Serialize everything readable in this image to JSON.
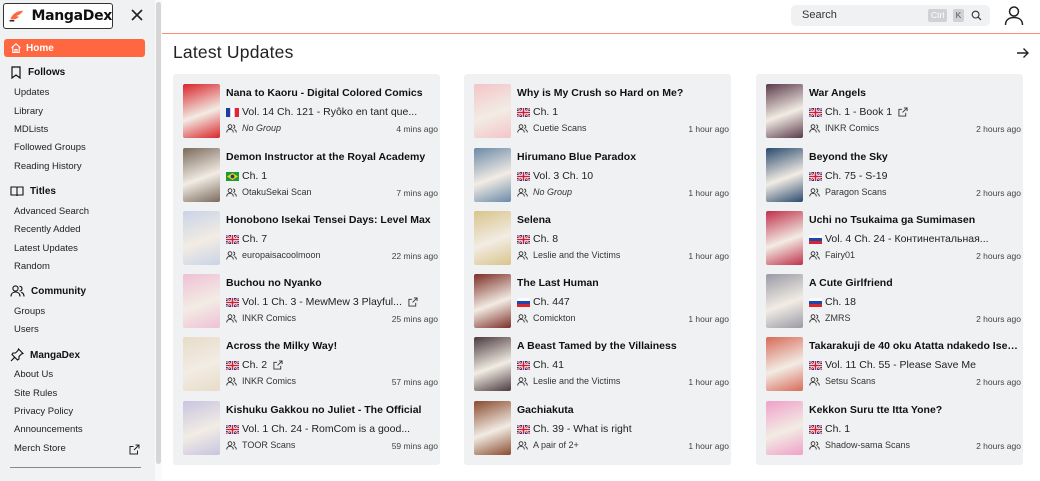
{
  "app": {
    "name": "MangaDex",
    "brand_color": "#ff6740"
  },
  "sidebar": {
    "home_label": "Home",
    "sections": [
      {
        "title": "Follows",
        "icon": "bookmark-icon",
        "items": [
          "Updates",
          "Library",
          "MDLists",
          "Followed Groups",
          "Reading History"
        ]
      },
      {
        "title": "Titles",
        "icon": "book-open-icon",
        "items": [
          "Advanced Search",
          "Recently Added",
          "Latest Updates",
          "Random"
        ]
      },
      {
        "title": "Community",
        "icon": "users-icon",
        "items": [
          "Groups",
          "Users"
        ]
      },
      {
        "title": "MangaDex",
        "icon": "pin-icon",
        "items": [
          "About Us",
          "Site Rules",
          "Privacy Policy",
          "Announcements",
          "Merch Store"
        ]
      }
    ]
  },
  "search": {
    "placeholder": "Search",
    "kbd_mod": "Ctrl",
    "kbd_key": "K"
  },
  "main": {
    "title": "Latest Updates"
  },
  "columns": [
    [
      {
        "title": "Nana to Kaoru - Digital Colored Comics",
        "flag": "fr",
        "chapter": "Vol. 14 Ch. 121 - Ryôko en tant que...",
        "group": "No Group",
        "group_italic": true,
        "time": "4 mins ago",
        "ext": false
      },
      {
        "title": "Demon Instructor at the Royal Academy",
        "flag": "br",
        "chapter": "Ch. 1",
        "group": "OtakuSekai Scan",
        "group_italic": false,
        "time": "7 mins ago",
        "ext": false
      },
      {
        "title": "Honobono Isekai Tensei Days: Level Max",
        "flag": "gb",
        "chapter": "Ch. 7",
        "group": "europaisacoolmoon",
        "group_italic": false,
        "time": "22 mins ago",
        "ext": false
      },
      {
        "title": "Buchou no Nyanko",
        "flag": "gb",
        "chapter": "Vol. 1 Ch. 3 - MewMew 3 Playful...",
        "group": "INKR Comics",
        "group_italic": false,
        "time": "25 mins ago",
        "ext": true
      },
      {
        "title": "Across the Milky Way!",
        "flag": "gb",
        "chapter": "Ch. 2",
        "group": "INKR Comics",
        "group_italic": false,
        "time": "57 mins ago",
        "ext": true
      },
      {
        "title": "Kishuku Gakkou no Juliet - The Official",
        "flag": "gb",
        "chapter": "Vol. 1 Ch. 24 - RomCom is a good...",
        "group": "TOOR Scans",
        "group_italic": false,
        "time": "59 mins ago",
        "ext": false
      }
    ],
    [
      {
        "title": "Why is My Crush so Hard on Me?",
        "flag": "gb",
        "chapter": "Ch. 1",
        "group": "Cuetie Scans",
        "group_italic": false,
        "time": "1 hour ago",
        "ext": false
      },
      {
        "title": "Hirumano Blue Paradox",
        "flag": "gb",
        "chapter": "Vol. 3 Ch. 10",
        "group": "No Group",
        "group_italic": true,
        "time": "1 hour ago",
        "ext": false
      },
      {
        "title": "Selena",
        "flag": "gb",
        "chapter": "Ch. 8",
        "group": "Leslie and the Victims",
        "group_italic": false,
        "time": "1 hour ago",
        "ext": false
      },
      {
        "title": "The Last Human",
        "flag": "ru",
        "chapter": "Ch. 447",
        "group": "Comickton",
        "group_italic": false,
        "time": "1 hour ago",
        "ext": false
      },
      {
        "title": "A Beast Tamed by the Villainess",
        "flag": "gb",
        "chapter": "Ch. 41",
        "group": "Leslie and the Victims",
        "group_italic": false,
        "time": "1 hour ago",
        "ext": false
      },
      {
        "title": "Gachiakuta",
        "flag": "gb",
        "chapter": "Ch. 39 - What is right",
        "group": "A pair of 2+",
        "group_italic": false,
        "time": "1 hour ago",
        "ext": false
      }
    ],
    [
      {
        "title": "War Angels",
        "flag": "gb",
        "chapter": "Ch. 1 - Book 1",
        "group": "INKR Comics",
        "group_italic": false,
        "time": "2 hours ago",
        "ext": true
      },
      {
        "title": "Beyond the Sky",
        "flag": "gb",
        "chapter": "Ch. 75 - S-19",
        "group": "Paragon Scans",
        "group_italic": false,
        "time": "2 hours ago",
        "ext": false
      },
      {
        "title": "Uchi no Tsukaima ga Sumimasen",
        "flag": "ru",
        "chapter": "Vol. 4 Ch. 24 - Континентальная...",
        "group": "Fairy01",
        "group_italic": false,
        "time": "2 hours ago",
        "ext": false
      },
      {
        "title": "A Cute Girlfriend",
        "flag": "ru",
        "chapter": "Ch. 18",
        "group": "ZMRS",
        "group_italic": false,
        "time": "2 hours ago",
        "ext": false
      },
      {
        "title": "Takarakuji de 40 oku Atatta ndakedo Isekai ni",
        "flag": "gb",
        "chapter": "Vol. 11 Ch. 55 - Please Save Me",
        "group": "Setsu Scans",
        "group_italic": false,
        "time": "2 hours ago",
        "ext": false
      },
      {
        "title": "Kekkon Suru tte Itta Yone?",
        "flag": "gb",
        "chapter": "Ch. 1",
        "group": "Shadow-sama Scans",
        "group_italic": false,
        "time": "2 hours ago",
        "ext": false
      }
    ]
  ],
  "cover_colors": [
    [
      "#d9242b",
      "#7a6a5c",
      "#c9d3e6",
      "#f0c0d6",
      "#e8dcc8",
      "#c8c4e0"
    ],
    [
      "#f4c4c8",
      "#6a8aa8",
      "#d8c48a",
      "#7c2e26",
      "#4a3a3e",
      "#8a4a2e"
    ],
    [
      "#5a3a4a",
      "#2a4a6e",
      "#c0304a",
      "#9a9aa6",
      "#d86a5a",
      "#f0a0c8"
    ]
  ]
}
